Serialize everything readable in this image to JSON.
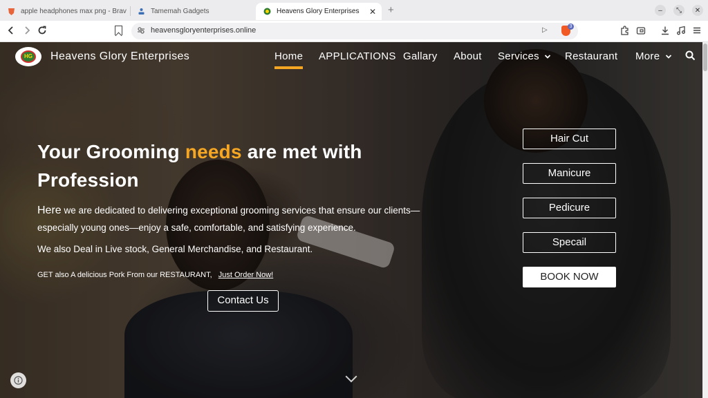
{
  "browser": {
    "tabs": [
      {
        "title": "apple headphones max png - Brav",
        "icon": "brave-search-icon",
        "active": false
      },
      {
        "title": "Tamemah Gadgets",
        "icon": "person-upload-icon",
        "active": false
      },
      {
        "title": "Heavens Glory Enterprises",
        "icon": "site-logo-icon",
        "active": true
      }
    ],
    "new_tab": "+",
    "url": "heavensgloryenterprises.online",
    "shields_count": "3",
    "window_controls": {
      "minimize": "–",
      "restore": "⤡",
      "close": "✕"
    }
  },
  "site": {
    "brand": "Heavens Glory Enterprises",
    "logo_text": "HG",
    "nav": [
      {
        "label": "Home",
        "active": true
      },
      {
        "label": "APPLICATIONS"
      },
      {
        "label": "Gallary"
      },
      {
        "label": "About"
      },
      {
        "label": "Services",
        "dropdown": true
      },
      {
        "label": "Restaurant"
      },
      {
        "label": "More",
        "dropdown": true
      }
    ],
    "hero": {
      "heading_part1": "Your Grooming ",
      "heading_accent": "needs",
      "heading_part2": " are met with Profession",
      "lead_word": "Here",
      "paragraph": " we are dedicated to delivering exceptional grooming services that ensure our clients—especially young ones—enjoy a safe, comfortable, and satisfying experience.",
      "line2": "We also Deal in Live stock, General Merchandise,  and Restaurant.",
      "line3": "GET also A delicious Pork From our RESTAURANT,",
      "order_link": "Just Order Now! ",
      "contact_button": "Contact Us"
    },
    "service_buttons": [
      "Hair Cut",
      "Manicure",
      "Pedicure",
      "Specail"
    ],
    "book_button": "BOOK NOW"
  },
  "colors": {
    "accent": "#f5a623",
    "text_on_hero": "#ffffff"
  }
}
